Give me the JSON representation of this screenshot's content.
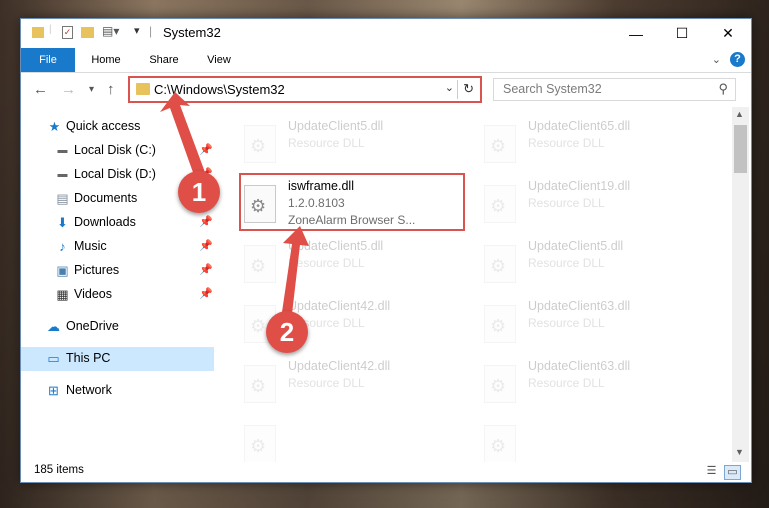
{
  "window": {
    "title": "System32",
    "controls": {
      "minimize": "—",
      "maximize": "☐",
      "close": "✕"
    }
  },
  "ribbon": {
    "tabs": [
      {
        "label": "File"
      },
      {
        "label": "Home"
      },
      {
        "label": "Share"
      },
      {
        "label": "View"
      }
    ],
    "help": "?"
  },
  "nav": {
    "address": "C:\\Windows\\System32",
    "search_placeholder": "Search System32"
  },
  "sidebar": {
    "items": [
      {
        "label": "Quick access"
      },
      {
        "label": "Local Disk (C:)"
      },
      {
        "label": "Local Disk (D:)"
      },
      {
        "label": "Documents"
      },
      {
        "label": "Downloads"
      },
      {
        "label": "Music"
      },
      {
        "label": "Pictures"
      },
      {
        "label": "Videos"
      },
      {
        "label": "OneDrive"
      },
      {
        "label": "This PC"
      },
      {
        "label": "Network"
      }
    ]
  },
  "files": {
    "highlighted": {
      "name": "iswframe.dll",
      "version": "1.2.0.8103",
      "description": "ZoneAlarm Browser S..."
    },
    "background": [
      {
        "name": "UpdateClient5.dll",
        "type": "Resource DLL"
      },
      {
        "name": "UpdateClient65.dll",
        "type": "Resource DLL"
      },
      {
        "name": "UpdateClient19.dll",
        "type": "Resource DLL"
      },
      {
        "name": "UpdateClient5.dll",
        "type": "Resource DLL"
      },
      {
        "name": "UpdateClient5.dll",
        "type": "Resource DLL"
      },
      {
        "name": "UpdateClient42.dll",
        "type": "Resource DLL"
      },
      {
        "name": "UpdateClient63.dll",
        "type": "Resource DLL"
      },
      {
        "name": "UpdateClient42.dll",
        "type": "Resource DLL"
      },
      {
        "name": "UpdateClient63.dll",
        "type": "Resource DLL"
      }
    ]
  },
  "status": {
    "item_count": "185 items"
  },
  "annotations": {
    "step1": "1",
    "step2": "2",
    "color": "#e04e48"
  }
}
